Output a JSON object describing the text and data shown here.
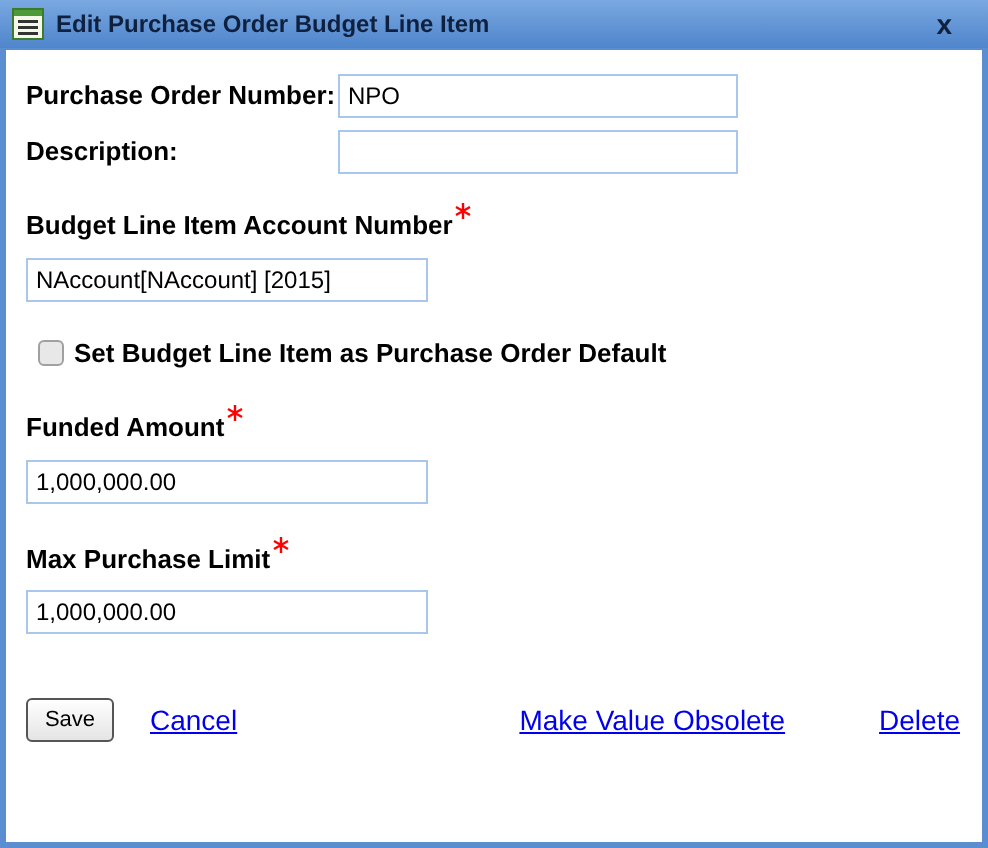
{
  "window": {
    "title": "Edit Purchase Order Budget Line Item",
    "close": "x"
  },
  "inline_fields": [
    {
      "label": "Purchase Order Number:",
      "value": "NPO"
    },
    {
      "label": "Description:"
    }
  ],
  "account": {
    "label": "Budget Line Item Account Number",
    "required": true,
    "value": "NAccount[NAccount] [2015]"
  },
  "default_checkbox": {
    "label": "Set Budget Line Item as Purchase Order Default",
    "checked": false
  },
  "amount_fields": [
    {
      "label": "Funded Amount",
      "required": true,
      "value": "1,000,000.00"
    },
    {
      "label": "Max Purchase Limit",
      "required": true,
      "value": "1,000,000.00"
    }
  ],
  "actions": {
    "save": "Save",
    "cancel": "Cancel",
    "obsolete": "Make Value Obsolete",
    "delete": "Delete"
  }
}
